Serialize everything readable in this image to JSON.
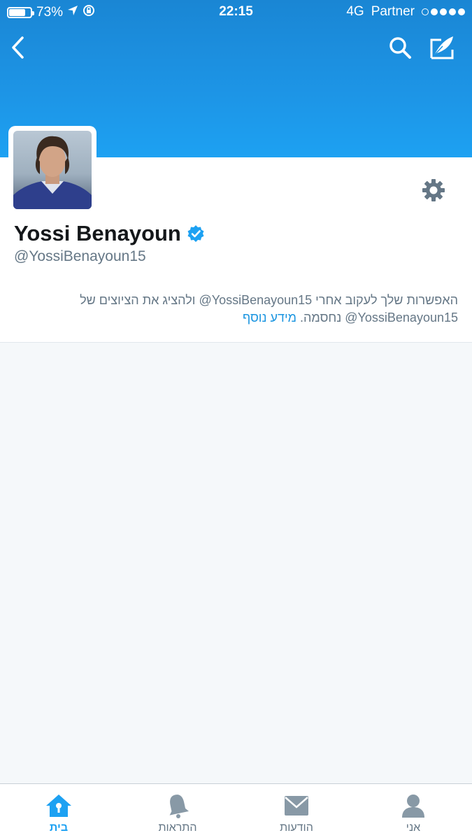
{
  "status_bar": {
    "battery": "73%",
    "time": "22:15",
    "network": "4G",
    "carrier": "Partner"
  },
  "profile": {
    "name": "Yossi Benayoun",
    "handle": "@YossiBenayoun15",
    "verified": true
  },
  "notice": {
    "line1": "האפשרות שלך לעקוב אחרי ‎@YossiBenayoun15‎ ולהציג את הציוצים של",
    "line2_prefix": "‎@YossiBenayoun15‎ נחסמה. ",
    "link": "מידע נוסף"
  },
  "tabs": [
    {
      "label": "בית",
      "icon": "home-icon",
      "active": true
    },
    {
      "label": "התראות",
      "icon": "bell-icon",
      "active": false
    },
    {
      "label": "הודעות",
      "icon": "envelope-icon",
      "active": false
    },
    {
      "label": "אני",
      "icon": "person-icon",
      "active": false
    }
  ],
  "colors": {
    "brand_blue": "#1da1f2",
    "link_blue": "#1b95e0",
    "tab_gray": "#657786",
    "verified_blue": "#1da1f2"
  }
}
